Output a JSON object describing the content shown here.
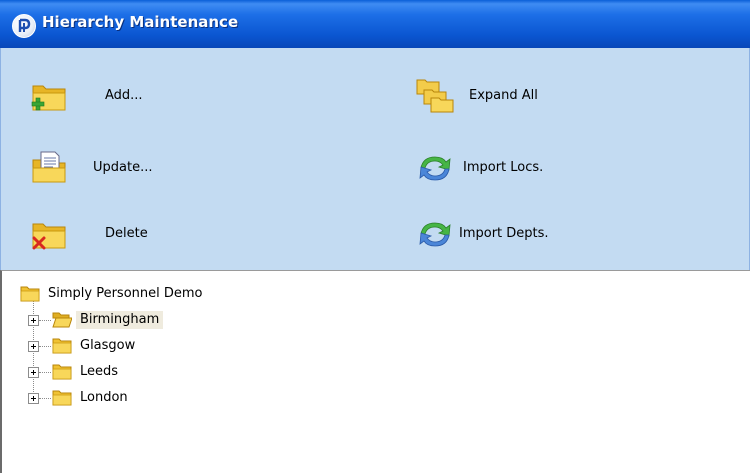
{
  "window": {
    "title": "Hierarchy Maintenance"
  },
  "toolbar": {
    "add_label": "Add...",
    "update_label": "Update...",
    "delete_label": "Delete",
    "expand_all_label": "Expand All",
    "import_locs_label": "Import Locs.",
    "import_depts_label": "Import Depts."
  },
  "tree": {
    "root": "Simply Personnel Demo",
    "children": [
      "Birmingham",
      "Glasgow",
      "Leeds",
      "London"
    ],
    "selected": "Birmingham"
  },
  "colors": {
    "titlebar": "#0a55d0",
    "toolbar_bg": "#c3dbf2",
    "selection_bg": "#efebde",
    "folder": "#f5c93a"
  }
}
